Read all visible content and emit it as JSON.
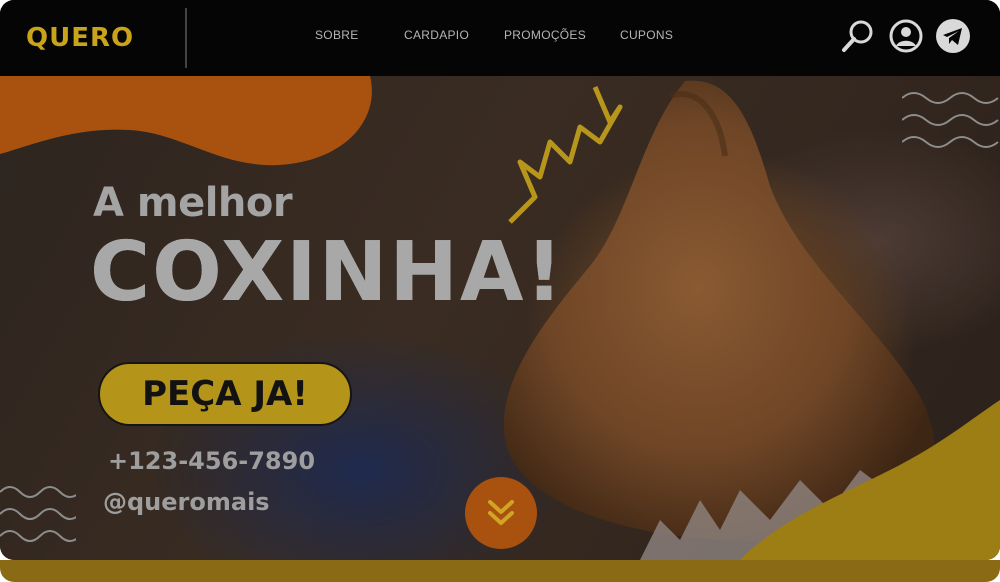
{
  "header": {
    "logo_text": "QUERO",
    "nav": [
      "SOBRE",
      "CARDAPIO",
      "PROMOÇÕES",
      "CUPONS"
    ],
    "icons": [
      "search-icon",
      "user-icon",
      "telegram-icon"
    ]
  },
  "hero": {
    "tagline": "A melhor",
    "headline": "COXINHA!",
    "cta_label": "PEÇA JA!",
    "phone": "+123-456-7890",
    "handle": "@queromais",
    "scroll_icon": "double-chevron-down-icon"
  },
  "colors": {
    "accent_orange": "#a9520f",
    "accent_yellow": "#b49419",
    "header_bg": "#050505"
  }
}
